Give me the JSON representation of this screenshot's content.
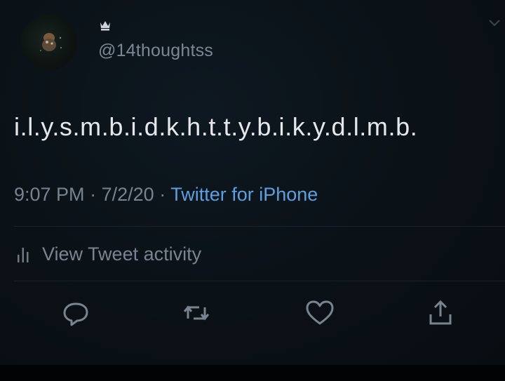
{
  "tweet": {
    "handle": "@14thoughtss",
    "text": "i.l.y.s.m.b.i.d.k.h.t.t.y.b.i.k.y.d.l.m.b.",
    "time": "9:07 PM",
    "date": "7/2/20",
    "separator": "·",
    "source": "Twitter for iPhone",
    "activity_label": "View Tweet activity"
  },
  "icons": {
    "name_badge": "crown-icon",
    "more": "chevron-down-icon",
    "activity": "bar-chart-icon",
    "actions": [
      "reply-icon",
      "retweet-icon",
      "like-icon",
      "share-icon"
    ]
  },
  "colors": {
    "background": "#0a1117",
    "text": "#e4e8ec",
    "secondary_text": "#79838d",
    "link": "#5d9fe0"
  }
}
